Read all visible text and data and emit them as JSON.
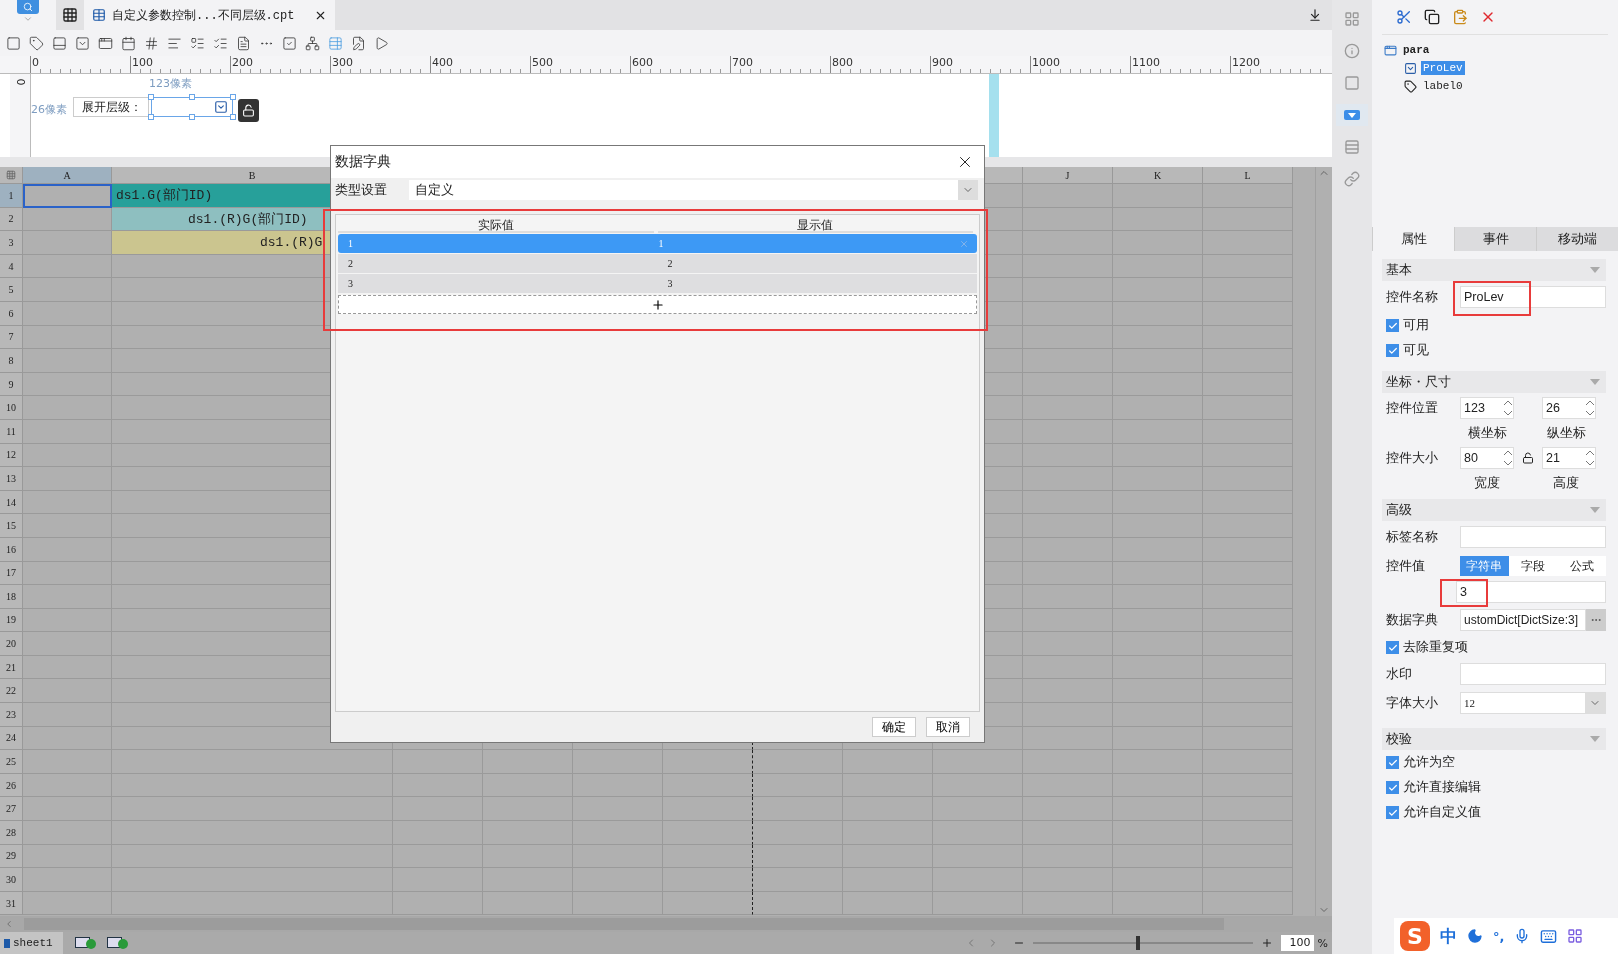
{
  "app": {
    "tab_title": "自定义参数控制...不同层级.cpt"
  },
  "side_tools": [
    {
      "kind": "layout",
      "selected": false
    },
    {
      "kind": "info",
      "selected": false
    },
    {
      "kind": "frame",
      "selected": false
    },
    {
      "kind": "widget",
      "selected": true
    },
    {
      "kind": "rows",
      "selected": false
    },
    {
      "kind": "link",
      "selected": false
    }
  ],
  "ruler": {
    "marks": [
      "0",
      "100",
      "200",
      "300",
      "400",
      "500",
      "600",
      "700",
      "800",
      "900",
      "1000",
      "1100",
      "1200"
    ],
    "vertical_mark": "0"
  },
  "param_canvas": {
    "x_offset_label": "123像素",
    "y_offset_label": "26像素",
    "label": "展开层级：",
    "combo_selected": true,
    "locked": false
  },
  "sheet": {
    "columns": [
      {
        "label": "A",
        "selected": true
      },
      {
        "label": "B",
        "selected": false
      },
      {
        "label": "J",
        "selected": false
      },
      {
        "label": "K",
        "selected": false
      },
      {
        "label": "L",
        "selected": false
      }
    ],
    "rows": [
      {
        "number": "1",
        "selected": true,
        "cell": {
          "text": "ds1.G(部门ID)",
          "color": "#27a09a"
        }
      },
      {
        "number": "2",
        "selected": false,
        "cell": {
          "text": "ds1.(R)G(部门ID)",
          "color": "#8ebfc0"
        }
      },
      {
        "number": "3",
        "selected": false,
        "cell": {
          "text": "ds1.(R)G",
          "color": "#cbc58f"
        }
      },
      {
        "number": "4",
        "selected": false
      },
      {
        "number": "5",
        "selected": false
      },
      {
        "number": "6",
        "selected": false
      },
      {
        "number": "7",
        "selected": false
      },
      {
        "number": "8",
        "selected": false
      },
      {
        "number": "9",
        "selected": false
      },
      {
        "number": "10",
        "selected": false
      },
      {
        "number": "11",
        "selected": false
      },
      {
        "number": "12",
        "selected": false
      },
      {
        "number": "13",
        "selected": false
      },
      {
        "number": "14",
        "selected": false
      },
      {
        "number": "15",
        "selected": false
      },
      {
        "number": "16",
        "selected": false
      },
      {
        "number": "17",
        "selected": false
      },
      {
        "number": "18",
        "selected": false
      },
      {
        "number": "19",
        "selected": false
      },
      {
        "number": "20",
        "selected": false
      },
      {
        "number": "21",
        "selected": false
      },
      {
        "number": "22",
        "selected": false
      },
      {
        "number": "23",
        "selected": false
      },
      {
        "number": "24",
        "selected": false
      },
      {
        "number": "25",
        "selected": false
      },
      {
        "number": "26",
        "selected": false
      },
      {
        "number": "27",
        "selected": false
      },
      {
        "number": "28",
        "selected": false
      },
      {
        "number": "29",
        "selected": false
      },
      {
        "number": "30",
        "selected": false
      },
      {
        "number": "31",
        "selected": false
      }
    ]
  },
  "status_bar": {
    "sheets": [
      {
        "label": "sheet1",
        "selected": true
      }
    ],
    "zoom": {
      "level": 0.48,
      "value": "100",
      "unit": "%"
    }
  },
  "dialog": {
    "title": "数据字典",
    "type_label": "类型设置",
    "type_value": "自定义",
    "highlighted": true,
    "columns": [
      "实际值",
      "显示值"
    ],
    "rows": [
      {
        "actual": "1",
        "display": "1",
        "selected": true
      },
      {
        "actual": "2",
        "display": "2",
        "selected": false
      },
      {
        "actual": "3",
        "display": "3",
        "selected": false
      }
    ],
    "buttons": [
      "确定",
      "取消"
    ]
  },
  "right_panel": {
    "tree": {
      "label": "para",
      "children": [
        {
          "label": "ProLev",
          "kind": "combo",
          "selected": true
        },
        {
          "label": "label0",
          "kind": "label",
          "selected": false
        }
      ]
    },
    "tabs": [
      {
        "label": "属性",
        "selected": true
      },
      {
        "label": "事件",
        "selected": false
      },
      {
        "label": "移动端",
        "selected": false
      }
    ],
    "basic": {
      "title": "基本",
      "name_label": "控件名称",
      "name_value": "ProLev",
      "name_highlighted": true,
      "checks": [
        {
          "label": "可用",
          "checked": true
        },
        {
          "label": "可见",
          "checked": true
        }
      ]
    },
    "geometry": {
      "title": "坐标・尺寸",
      "rows": [
        {
          "label": "控件位置",
          "lock": false,
          "fields": [
            {
              "value": "123",
              "caption": "横坐标"
            },
            {
              "value": "26",
              "caption": "纵坐标"
            }
          ]
        },
        {
          "label": "控件大小",
          "lock": true,
          "fields": [
            {
              "value": "80",
              "caption": "宽度"
            },
            {
              "value": "21",
              "caption": "高度"
            }
          ]
        }
      ]
    },
    "advanced": {
      "title": "高级",
      "tag_label": "标签名称",
      "value_label": "控件值",
      "value_modes": [
        {
          "label": "字符串",
          "selected": true
        },
        {
          "label": "字段",
          "selected": false
        },
        {
          "label": "公式",
          "selected": false
        }
      ],
      "value": "3",
      "value_highlighted": true,
      "dict_label": "数据字典",
      "dict_value": "ustomDict[DictSize:3]",
      "dedupe": {
        "label": "去除重复项",
        "checked": true
      },
      "watermark_label": "水印",
      "font_size_label": "字体大小",
      "font_size": "12"
    },
    "validation": {
      "title": "校验",
      "checks": [
        {
          "label": "允许为空",
          "checked": true
        },
        {
          "label": "允许直接编辑",
          "checked": true
        },
        {
          "label": "允许自定义值",
          "checked": true
        }
      ]
    }
  },
  "ime": {
    "logo": "S",
    "mode": "中",
    "symbol": "°,"
  }
}
